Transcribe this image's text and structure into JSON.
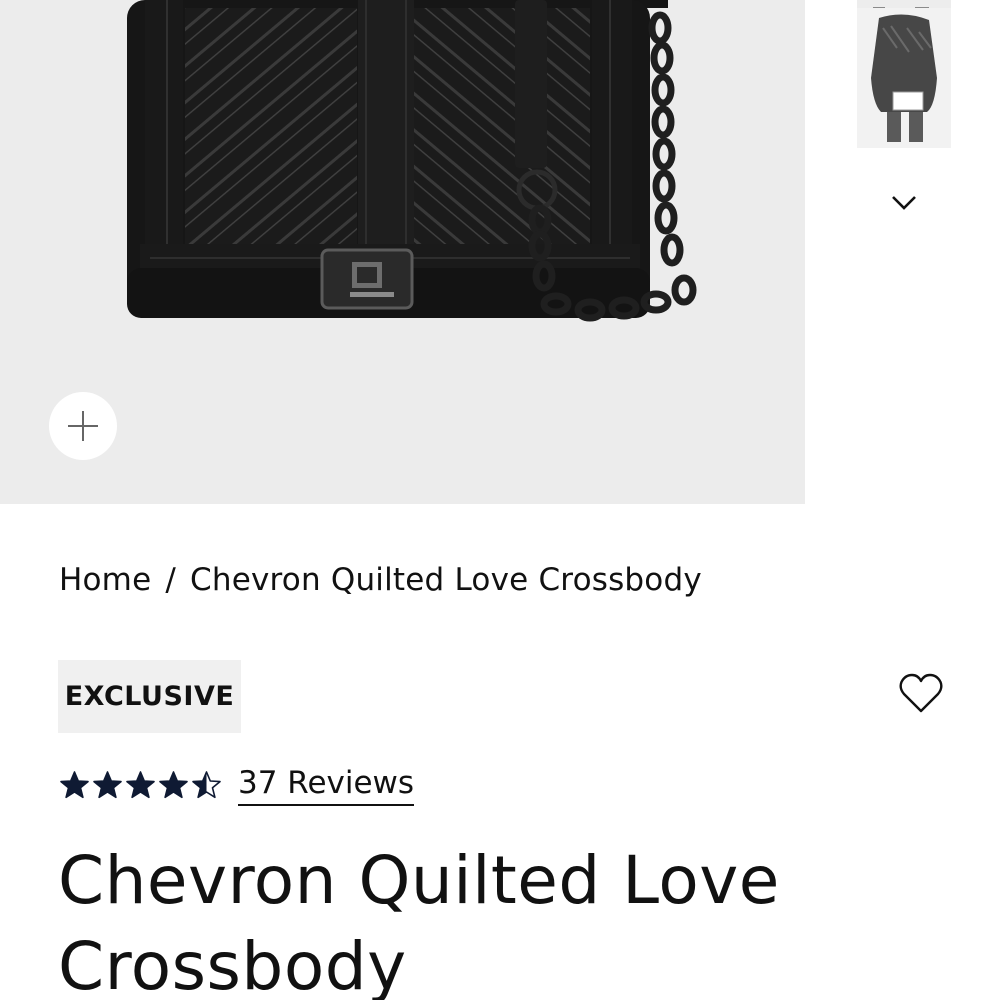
{
  "gallery": {
    "zoom_icon": "plus-icon",
    "thumbs_down_icon": "chevron-down-icon"
  },
  "breadcrumb": {
    "home": "Home",
    "separator": "/",
    "current": "Chevron Quilted Love Crossbody"
  },
  "product": {
    "badge": "EXCLUSIVE",
    "wishlist_icon": "heart-outline-icon",
    "rating": 4.5,
    "rating_max": 5,
    "reviews_label": "37 Reviews",
    "title": "Chevron Quilted Love Crossbody"
  },
  "colors": {
    "text": "#111111",
    "gallery_bg": "#ececec",
    "badge_bg": "#f0f0f0",
    "star": "#0f1a33"
  }
}
